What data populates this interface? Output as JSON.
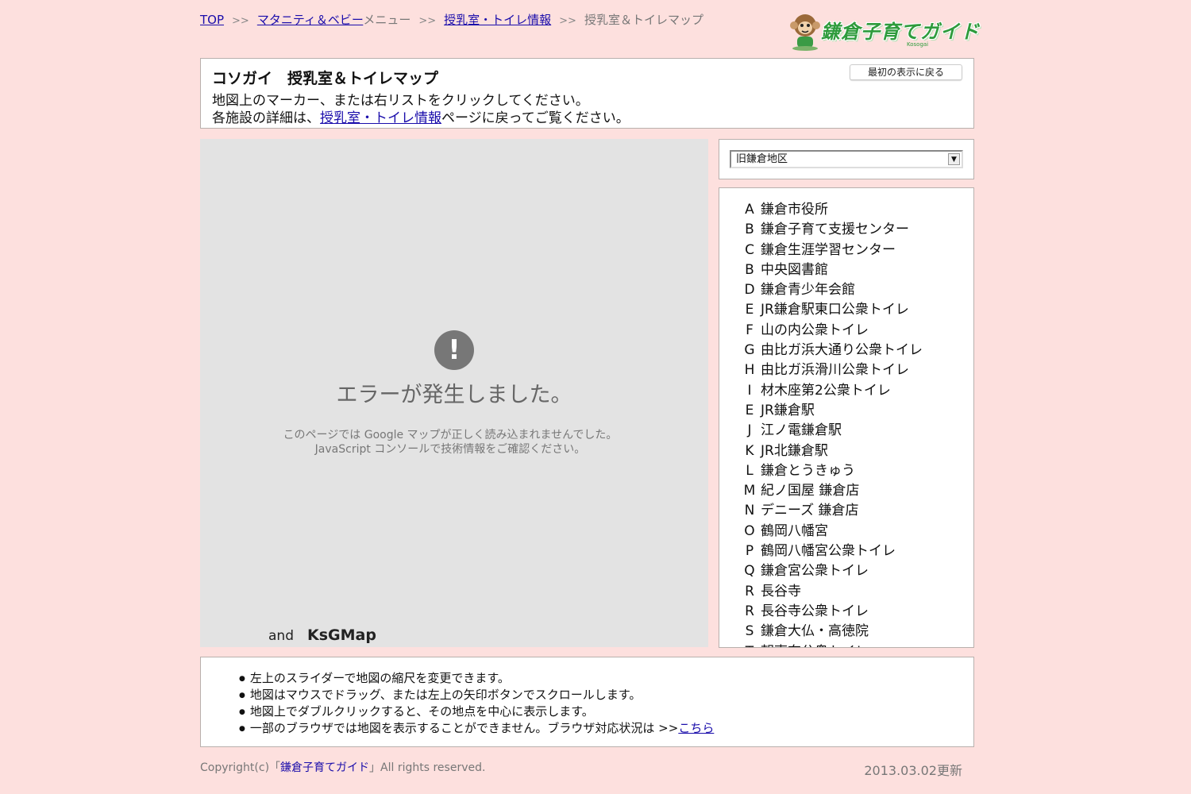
{
  "breadcrumb": {
    "top": "TOP",
    "sep": ">>",
    "maternity_link": "マタニティ＆ベビー",
    "maternity_rest": "メニュー",
    "nursing_link": "授乳室・トイレ情報",
    "current": "授乳室＆トイレマップ"
  },
  "logo": {
    "text": "鎌倉子育てガイド",
    "sub": "Kosogai"
  },
  "header": {
    "title": "コソガイ　授乳室＆トイレマップ",
    "desc1": "地図上のマーカー、または右リストをクリックしてください。",
    "desc2_pre": "各施設の詳細は、",
    "desc2_link": "授乳室・トイレ情報",
    "desc2_post": "ページに戻ってご覧ください。",
    "reset_label": "最初の表示に戻る"
  },
  "map": {
    "error_icon": "!",
    "error_title": "エラーが発生しました。",
    "error_msg1": "このページでは Google マップが正しく読み込まれませんでした。",
    "error_msg2": "JavaScript コンソールで技術情報をご確認ください。",
    "credit_and": "and",
    "credit_name": "KsGMap"
  },
  "selector": {
    "selected": "旧鎌倉地区",
    "arrow": "▼"
  },
  "facilities": [
    {
      "letter": "A",
      "name": "鎌倉市役所"
    },
    {
      "letter": "B",
      "name": "鎌倉子育て支援センター"
    },
    {
      "letter": "C",
      "name": "鎌倉生涯学習センター"
    },
    {
      "letter": "B",
      "name": "中央図書館"
    },
    {
      "letter": "D",
      "name": "鎌倉青少年会館"
    },
    {
      "letter": "E",
      "name": "JR鎌倉駅東口公衆トイレ"
    },
    {
      "letter": "F",
      "name": "山の内公衆トイレ"
    },
    {
      "letter": "G",
      "name": "由比ガ浜大通り公衆トイレ"
    },
    {
      "letter": "H",
      "name": "由比ガ浜滑川公衆トイレ"
    },
    {
      "letter": "I",
      "name": "材木座第2公衆トイレ"
    },
    {
      "letter": "E",
      "name": "JR鎌倉駅"
    },
    {
      "letter": "J",
      "name": "江ノ電鎌倉駅"
    },
    {
      "letter": "K",
      "name": "JR北鎌倉駅"
    },
    {
      "letter": "L",
      "name": "鎌倉とうきゅう"
    },
    {
      "letter": "M",
      "name": "紀ノ国屋 鎌倉店"
    },
    {
      "letter": "N",
      "name": "デニーズ 鎌倉店"
    },
    {
      "letter": "O",
      "name": "鶴岡八幡宮"
    },
    {
      "letter": "P",
      "name": "鶴岡八幡宮公衆トイレ"
    },
    {
      "letter": "Q",
      "name": "鎌倉宮公衆トイレ"
    },
    {
      "letter": "R",
      "name": "長谷寺"
    },
    {
      "letter": "R",
      "name": "長谷寺公衆トイレ"
    },
    {
      "letter": "S",
      "name": "鎌倉大仏・高徳院"
    },
    {
      "letter": "T",
      "name": "朝夷奈公衆トイレ"
    }
  ],
  "notes": {
    "n1": "左上のスライダーで地図の縮尺を変更できます。",
    "n2": "地図はマウスでドラッグ、または左上の矢印ボタンでスクロールします。",
    "n3": "地図上でダブルクリックすると、その地点を中心に表示します。",
    "n4_pre": "一部のブラウザでは地図を表示することができません。ブラウザ対応状況は >>",
    "n4_link": "こちら"
  },
  "footer": {
    "copy_pre": "Copyright(c)「",
    "brand": "鎌倉子育てガイド",
    "copy_post": "」All rights reserved.",
    "updated": "2013.03.02更新"
  },
  "colors": {
    "background": "#fde0de",
    "link": "#1a0dab",
    "logo_green": "#2e9b3c"
  }
}
